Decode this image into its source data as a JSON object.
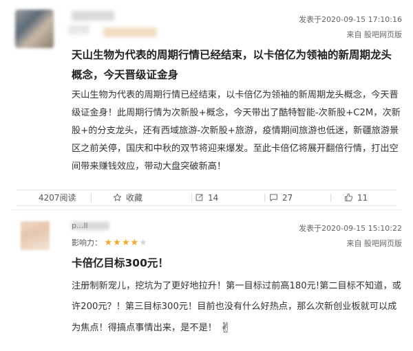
{
  "posts": [
    {
      "posted_time": "发表于2020-09-15 17:10:16",
      "source": "来自 股吧网页版",
      "title": "天山生物为代表的周期行情已经结束，以卡倍亿为领袖的新周期龙头概念，今天晋级证金身",
      "body": "天山生物为代表的周期行情已经结束，以卡倍亿为领袖的新周期龙头概念，今天晋级证金身！此周期行情为次新股+概念，今天带出了酷特智能-次新股+C2M，次新股+的分支龙头，还有西域旅游-次新股+旅游，疫情期间旅游也低迷，新疆旅游景区之前关停，国庆和中秋的双节将迎来爆发。至此卡倍亿将展开翻倍行情，打出空间带来赚钱效应，带动大盘突破新高！",
      "actions": {
        "reads": "4207阅读",
        "favorite": "收藏",
        "shares": "14",
        "comments": "27",
        "likes": "11"
      }
    },
    {
      "username_partial": "p...ll",
      "posted_time": "发表于2020-09-15 15:10:22",
      "source": "来自 股吧网页版",
      "influence_label": "影响力：",
      "influence_rating": 4,
      "influence_max": 5,
      "title": "卡倍亿目标300元！",
      "body": "注册制新宠儿，挖坑为了更好地拉升！第一目标过前高180元!第二目标不知道，或许200元？！第三目标300元！目前也没有什么好热点，那么次新创业板就可以成为焦点！得搞点事情出来，是不是！",
      "emoji": "✌"
    }
  ],
  "colors": {
    "star_active": "#f5a623",
    "star_inactive": "#d6d6d6"
  }
}
